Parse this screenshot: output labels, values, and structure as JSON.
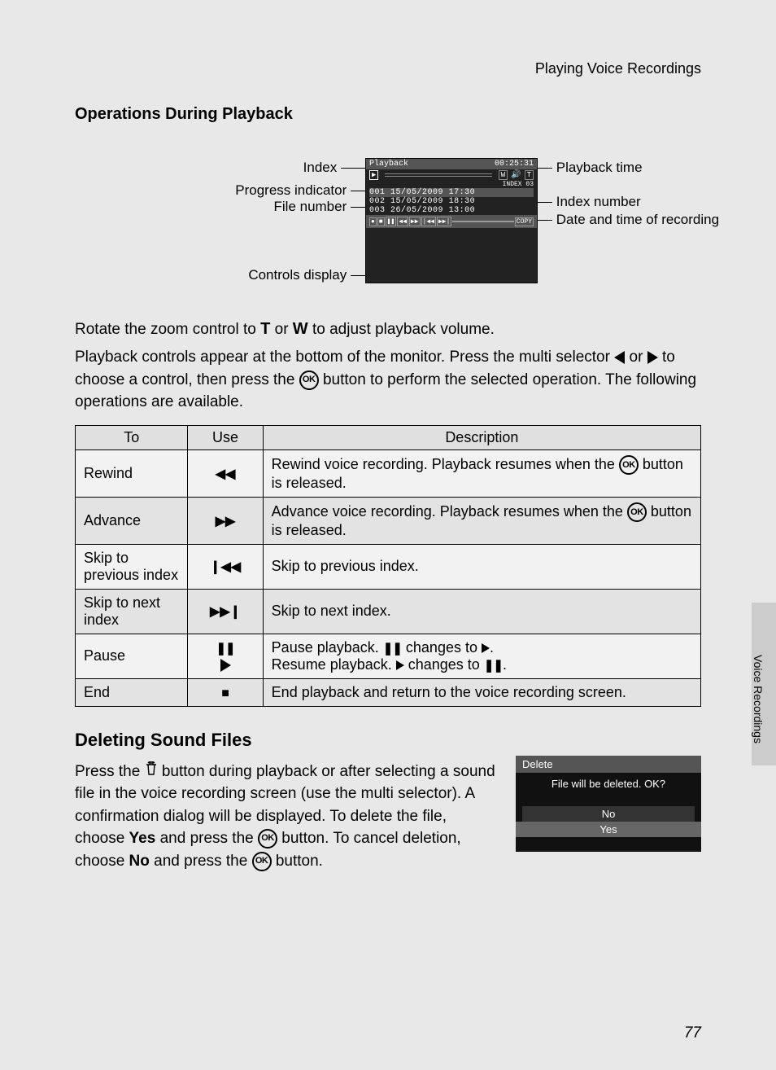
{
  "header_right": "Playing Voice Recordings",
  "section1_title": "Operations During Playback",
  "diagram": {
    "labels": {
      "index": "Index",
      "progress": "Progress indicator",
      "file_num": "File number",
      "controls": "Controls display",
      "playback_time": "Playback time",
      "index_num": "Index number",
      "date_time": "Date and time of recording"
    },
    "lcd": {
      "title": "Playback",
      "time": "00:25:31",
      "index_label": "INDEX 03",
      "files": [
        {
          "num": "001",
          "date": "15/05/2009",
          "time": "17:30",
          "sel": true
        },
        {
          "num": "002",
          "date": "15/05/2009",
          "time": "18:30",
          "sel": false
        },
        {
          "num": "003",
          "date": "26/05/2009",
          "time": "13:00",
          "sel": false
        }
      ],
      "copy": "COPY"
    }
  },
  "para1_a": "Rotate the zoom control to ",
  "para1_t": "T",
  "para1_b": " or ",
  "para1_w": "W",
  "para1_c": " to adjust playback volume.",
  "para2_a": "Playback controls appear at the bottom of the monitor. Press the multi selector ",
  "para2_b": " or ",
  "para2_c": " to choose a control, then press the ",
  "para2_d": " button to perform the selected operation. The following operations are available.",
  "table": {
    "headers": {
      "to": "To",
      "use": "Use",
      "desc": "Description"
    },
    "rows": [
      {
        "to": "Rewind",
        "use": "rwd",
        "desc_a": "Rewind voice recording. Playback resumes when the ",
        "desc_b": " button is released."
      },
      {
        "to": "Advance",
        "use": "fwd",
        "desc_a": "Advance voice recording. Playback resumes when the ",
        "desc_b": " button is released."
      },
      {
        "to": "Skip to previous index",
        "use": "skpp",
        "desc_a": "Skip to previous index.",
        "desc_b": ""
      },
      {
        "to": "Skip to next index",
        "use": "skpn",
        "desc_a": "Skip to next index.",
        "desc_b": ""
      },
      {
        "to": "Pause",
        "use": "pause",
        "desc_a": "Pause playback. ",
        "desc_mid": " changes to ",
        "desc_a2": ".",
        "desc_c": "Resume playback. ",
        "desc_mid2": " changes to ",
        "desc_c2": "."
      },
      {
        "to": "End",
        "use": "stop",
        "desc_a": "End playback and return to the voice recording screen.",
        "desc_b": ""
      }
    ]
  },
  "section2_title": "Deleting Sound Files",
  "delete_para_a": "Press the ",
  "delete_para_b": " button during playback or after selecting a sound file in the voice recording screen (use the multi selector). A confirmation dialog will be displayed. To delete the file, choose ",
  "delete_yes": "Yes",
  "delete_para_c": " and press the ",
  "delete_para_d": " button. To cancel deletion, choose ",
  "delete_no": "No",
  "delete_para_e": " and press the ",
  "delete_para_f": " button.",
  "dialog": {
    "title": "Delete",
    "msg": "File will be deleted. OK?",
    "no": "No",
    "yes": "Yes"
  },
  "side_tab": "Voice Recordings",
  "page_num": "77",
  "ok": "OK"
}
